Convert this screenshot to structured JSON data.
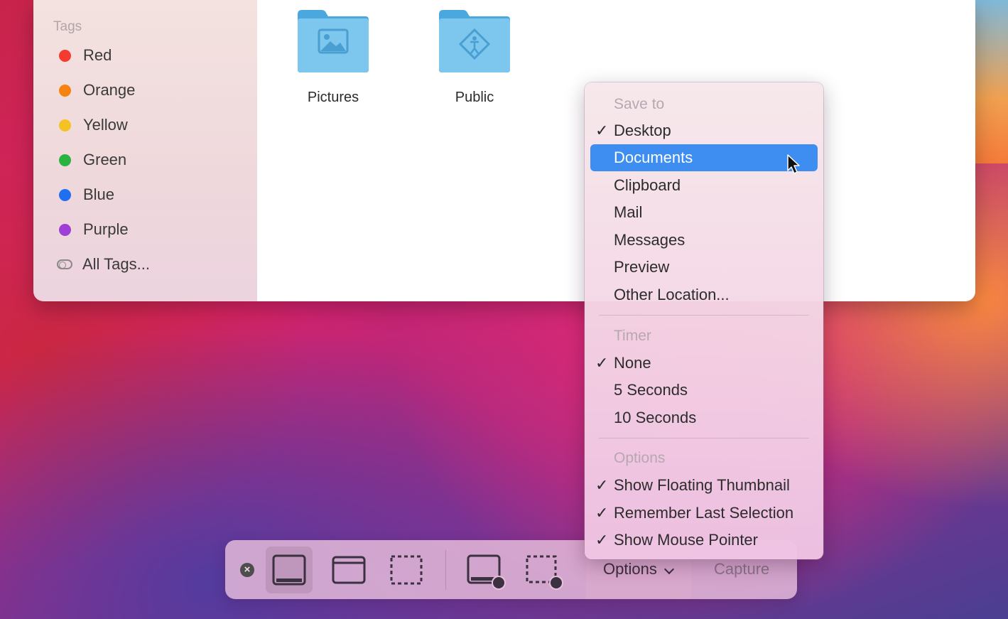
{
  "sidebar": {
    "heading": "Tags",
    "tags": [
      {
        "label": "Red",
        "color": "#f43b30"
      },
      {
        "label": "Orange",
        "color": "#f6830f"
      },
      {
        "label": "Yellow",
        "color": "#f5c224"
      },
      {
        "label": "Green",
        "color": "#2bb33f"
      },
      {
        "label": "Blue",
        "color": "#1f6ff0"
      },
      {
        "label": "Purple",
        "color": "#9f3fd6"
      }
    ],
    "all_tags": "All Tags..."
  },
  "folders": [
    {
      "label": "Pictures",
      "icon": "pictures-folder-icon"
    },
    {
      "label": "Public",
      "icon": "public-folder-icon"
    }
  ],
  "menu": {
    "save_to": {
      "heading": "Save to",
      "items": [
        {
          "label": "Desktop",
          "checked": true
        },
        {
          "label": "Documents",
          "checked": false,
          "highlighted": true
        },
        {
          "label": "Clipboard",
          "checked": false
        },
        {
          "label": "Mail",
          "checked": false
        },
        {
          "label": "Messages",
          "checked": false
        },
        {
          "label": "Preview",
          "checked": false
        },
        {
          "label": "Other Location...",
          "checked": false
        }
      ]
    },
    "timer": {
      "heading": "Timer",
      "items": [
        {
          "label": "None",
          "checked": true
        },
        {
          "label": "5 Seconds",
          "checked": false
        },
        {
          "label": "10 Seconds",
          "checked": false
        }
      ]
    },
    "options": {
      "heading": "Options",
      "items": [
        {
          "label": "Show Floating Thumbnail",
          "checked": true
        },
        {
          "label": "Remember Last Selection",
          "checked": true
        },
        {
          "label": "Show Mouse Pointer",
          "checked": true
        }
      ]
    },
    "check_glyph": "✓",
    "highlight_color": "#3e8ef1"
  },
  "toolbar": {
    "close_glyph": "×",
    "options_label": "Options",
    "capture_label": "Capture",
    "buttons": [
      {
        "icon": "capture-entire-screen-icon",
        "selected": true
      },
      {
        "icon": "capture-window-icon",
        "selected": false
      },
      {
        "icon": "capture-selection-icon",
        "selected": false
      },
      {
        "icon": "record-entire-screen-icon",
        "selected": false
      },
      {
        "icon": "record-selection-icon",
        "selected": false
      }
    ]
  }
}
